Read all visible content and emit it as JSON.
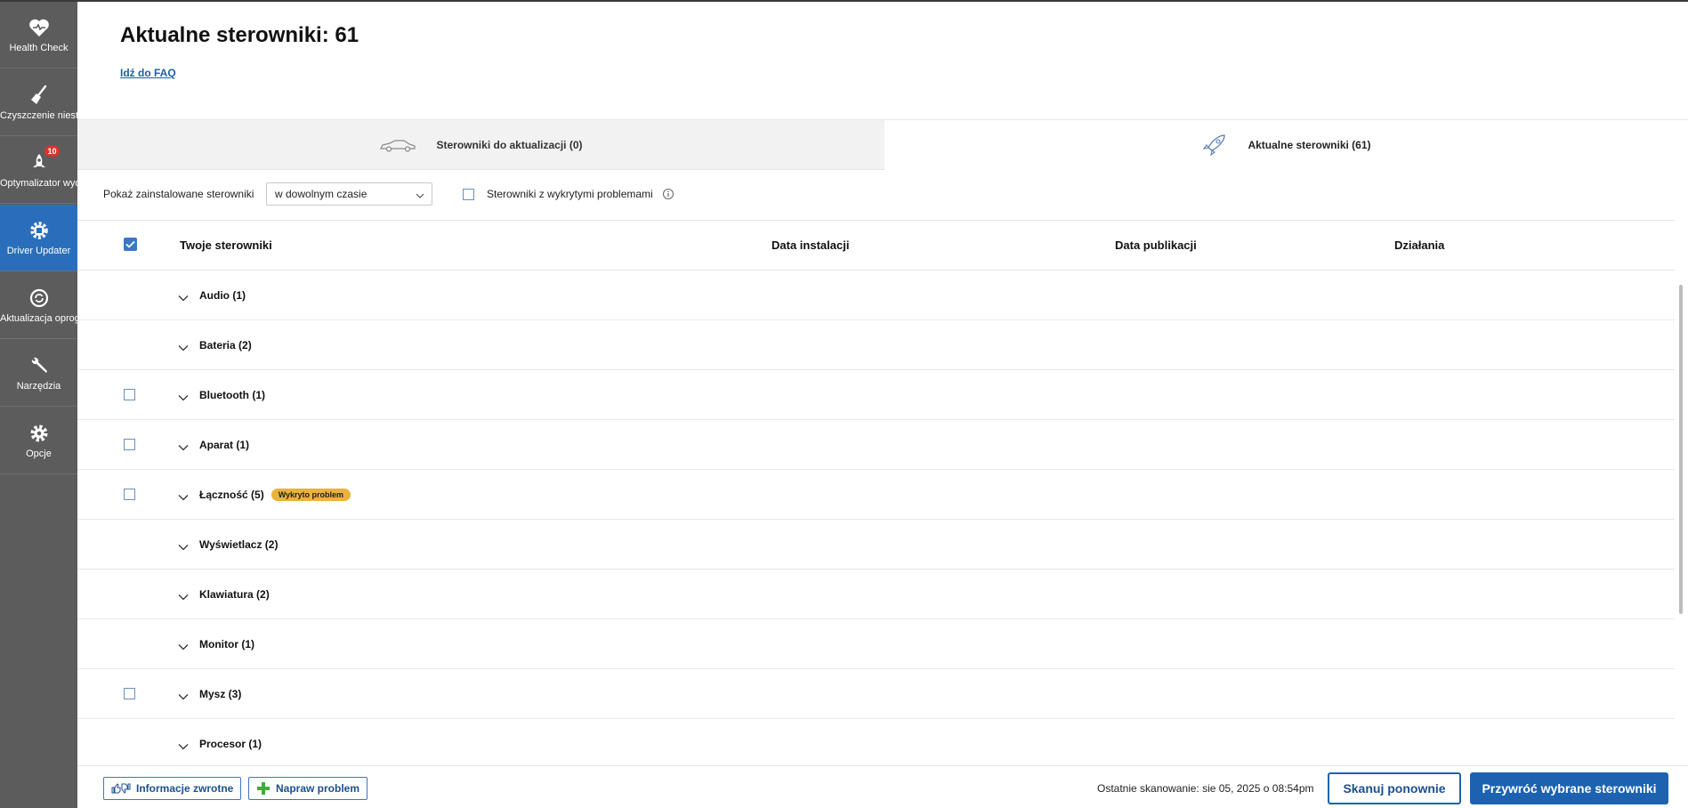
{
  "sidebar": {
    "items": [
      {
        "label": "Health Check",
        "icon": "heart-icon",
        "active": false
      },
      {
        "label": "Czyszczenie niestandardowe",
        "icon": "broom-icon",
        "active": false
      },
      {
        "label": "Optymalizator wydajności",
        "icon": "rocket-icon",
        "badge": "10",
        "active": false
      },
      {
        "label": "Driver Updater",
        "icon": "chip-gear-icon",
        "active": true
      },
      {
        "label": "Aktualizacja oprogramowania",
        "icon": "refresh-icon",
        "active": false
      },
      {
        "label": "Narzędzia",
        "icon": "wrench-icon",
        "active": false
      },
      {
        "label": "Opcje",
        "icon": "gear-icon",
        "active": false
      }
    ]
  },
  "header": {
    "title": "Aktualne sterowniki: 61",
    "faq_link": "Idź do FAQ"
  },
  "tabs": [
    {
      "label": "Sterowniki do aktualizacji (0)",
      "icon": "car-icon",
      "active": false
    },
    {
      "label": "Aktualne sterowniki (61)",
      "icon": "rocket-outline-icon",
      "active": true
    }
  ],
  "filters": {
    "show_label": "Pokaż zainstalowane sterowniki",
    "time_select_value": "w dowolnym czasie",
    "problems_checkbox_label": "Sterowniki z wykrytymi problemami",
    "problems_checked": false
  },
  "table": {
    "columns": [
      "Twoje sterowniki",
      "Data instalacji",
      "Data publikacji",
      "Działania"
    ],
    "select_all_checked": true,
    "rows": [
      {
        "label": "Audio (1)",
        "checkbox": false,
        "badge": ""
      },
      {
        "label": "Bateria (2)",
        "checkbox": false,
        "badge": ""
      },
      {
        "label": "Bluetooth (1)",
        "checkbox": true,
        "badge": ""
      },
      {
        "label": "Aparat (1)",
        "checkbox": true,
        "badge": ""
      },
      {
        "label": "Łączność (5)",
        "checkbox": true,
        "badge": "Wykryto problem"
      },
      {
        "label": "Wyświetlacz (2)",
        "checkbox": false,
        "badge": ""
      },
      {
        "label": "Klawiatura (2)",
        "checkbox": false,
        "badge": ""
      },
      {
        "label": "Monitor (1)",
        "checkbox": false,
        "badge": ""
      },
      {
        "label": "Mysz (3)",
        "checkbox": true,
        "badge": ""
      },
      {
        "label": "Procesor (1)",
        "checkbox": false,
        "badge": ""
      }
    ]
  },
  "footer": {
    "feedback_label": "Informacje zwrotne",
    "fix_label": "Napraw problem",
    "last_scan": "Ostatnie skanowanie: sie 05, 2025 o 08:54pm",
    "rescan_label": "Skanuj ponownie",
    "restore_label": "Przywróć wybrane sterowniki"
  },
  "colors": {
    "sidebar_bg": "#5c5c5c",
    "sidebar_active": "#2a6ebb",
    "accent": "#1d62b0",
    "badge_problem": "#e9b33c",
    "notification_badge": "#d9342b"
  }
}
